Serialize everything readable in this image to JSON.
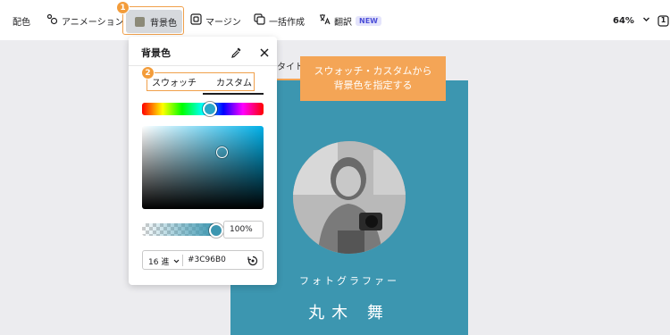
{
  "toolbar": {
    "color_scheme": "配色",
    "animation": "アニメーション",
    "background": "背景色",
    "margin": "マージン",
    "bulk_create": "一括作成",
    "translate": "翻訳",
    "new_badge": "NEW",
    "zoom": "64%",
    "page_count": "1"
  },
  "badges": {
    "one": "1",
    "two": "2"
  },
  "callout": {
    "line1": "スウォッチ・カスタムから",
    "line2": "背景色を指定する"
  },
  "panel": {
    "title": "背景色",
    "tabs": [
      "スウォッチ",
      "カスタム"
    ],
    "active_tab": "カスタム",
    "opacity": "100%",
    "color_mode": "16 進",
    "hex_value": "#3C96B0",
    "selected_color": "#3C96B0"
  },
  "canvas": {
    "partial_title": "タイト",
    "role": "フォトグラファー",
    "name": "丸木 舞",
    "background_color": "#3C96B0"
  },
  "icons": [
    "animation-icon",
    "margin-icon",
    "bulk-create-icon",
    "translate-icon",
    "chevron-down-icon",
    "page-icon",
    "eyedropper-icon",
    "close-icon",
    "reset-color-icon"
  ]
}
